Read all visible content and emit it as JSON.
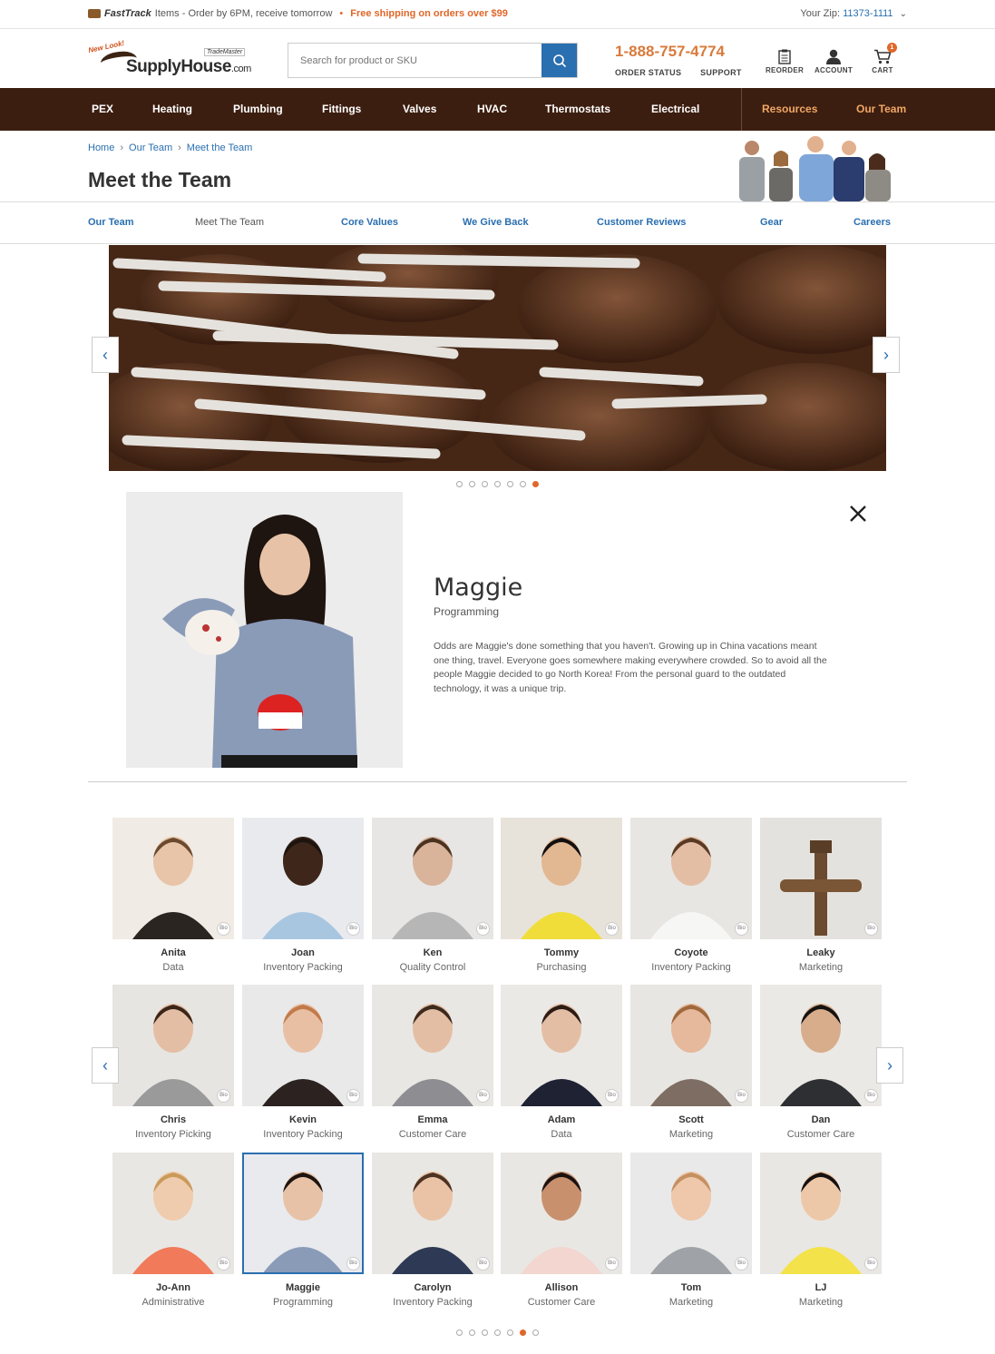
{
  "topbar": {
    "fasttrack_label": "FastTrack",
    "fasttrack_text": "Items - Order by 6PM, receive tomorrow",
    "separator": "•",
    "shipping_text": "Free shipping on orders over $99",
    "zip_label": "Your Zip:",
    "zip_value": "11373-1111"
  },
  "header": {
    "logo_newlook": "New Look!",
    "logo_trademaster": "TradeMaster",
    "logo_name": "SupplyHouse",
    "logo_suffix": ".com",
    "search_placeholder": "Search for product or SKU",
    "phone": "1-888-757-4774",
    "order_status": "ORDER STATUS",
    "support": "SUPPORT",
    "reorder": "REORDER",
    "account": "ACCOUNT",
    "cart": "CART",
    "cart_count": "1"
  },
  "nav": {
    "items": [
      "PEX",
      "Heating",
      "Plumbing",
      "Fittings",
      "Valves",
      "HVAC",
      "Thermostats",
      "Electrical"
    ],
    "resources": "Resources",
    "our_team": "Our Team"
  },
  "breadcrumb": [
    "Home",
    "Our Team",
    "Meet the Team"
  ],
  "page_title": "Meet the Team",
  "subnav": [
    "Our Team",
    "Meet The Team",
    "Core Values",
    "We Give Back",
    "Customer Reviews",
    "Gear",
    "Careers"
  ],
  "subnav_current": "Meet The Team",
  "banner": {
    "slides": 7,
    "active": 7
  },
  "bio": {
    "name": "Maggie",
    "role": "Programming",
    "text": "Odds are Maggie's done something that you haven't. Growing up in China vacations meant one thing, travel. Everyone goes somewhere making everywhere crowded. So to avoid all the people Maggie decided to go North Korea! From the personal guard to the outdated technology, it was a unique trip."
  },
  "bio_badge": "Bio",
  "team": [
    {
      "name": "Anita",
      "role": "Data"
    },
    {
      "name": "Joan",
      "role": "Inventory Packing"
    },
    {
      "name": "Ken",
      "role": "Quality Control"
    },
    {
      "name": "Tommy",
      "role": "Purchasing"
    },
    {
      "name": "Coyote",
      "role": "Inventory Packing"
    },
    {
      "name": "Leaky",
      "role": "Marketing"
    },
    {
      "name": "Chris",
      "role": "Inventory Picking"
    },
    {
      "name": "Kevin",
      "role": "Inventory Packing"
    },
    {
      "name": "Emma",
      "role": "Customer Care"
    },
    {
      "name": "Adam",
      "role": "Data"
    },
    {
      "name": "Scott",
      "role": "Marketing"
    },
    {
      "name": "Dan",
      "role": "Customer Care"
    },
    {
      "name": "Jo-Ann",
      "role": "Administrative"
    },
    {
      "name": "Maggie",
      "role": "Programming"
    },
    {
      "name": "Carolyn",
      "role": "Inventory Packing"
    },
    {
      "name": "Allison",
      "role": "Customer Care"
    },
    {
      "name": "Tom",
      "role": "Marketing"
    },
    {
      "name": "LJ",
      "role": "Marketing"
    }
  ],
  "team_selected": 13,
  "grid_dots": {
    "count": 7,
    "active": 6
  },
  "colors": {
    "accent_blue": "#2a6fb0",
    "accent_orange": "#e0672a",
    "nav_brown": "#3c1e10"
  }
}
